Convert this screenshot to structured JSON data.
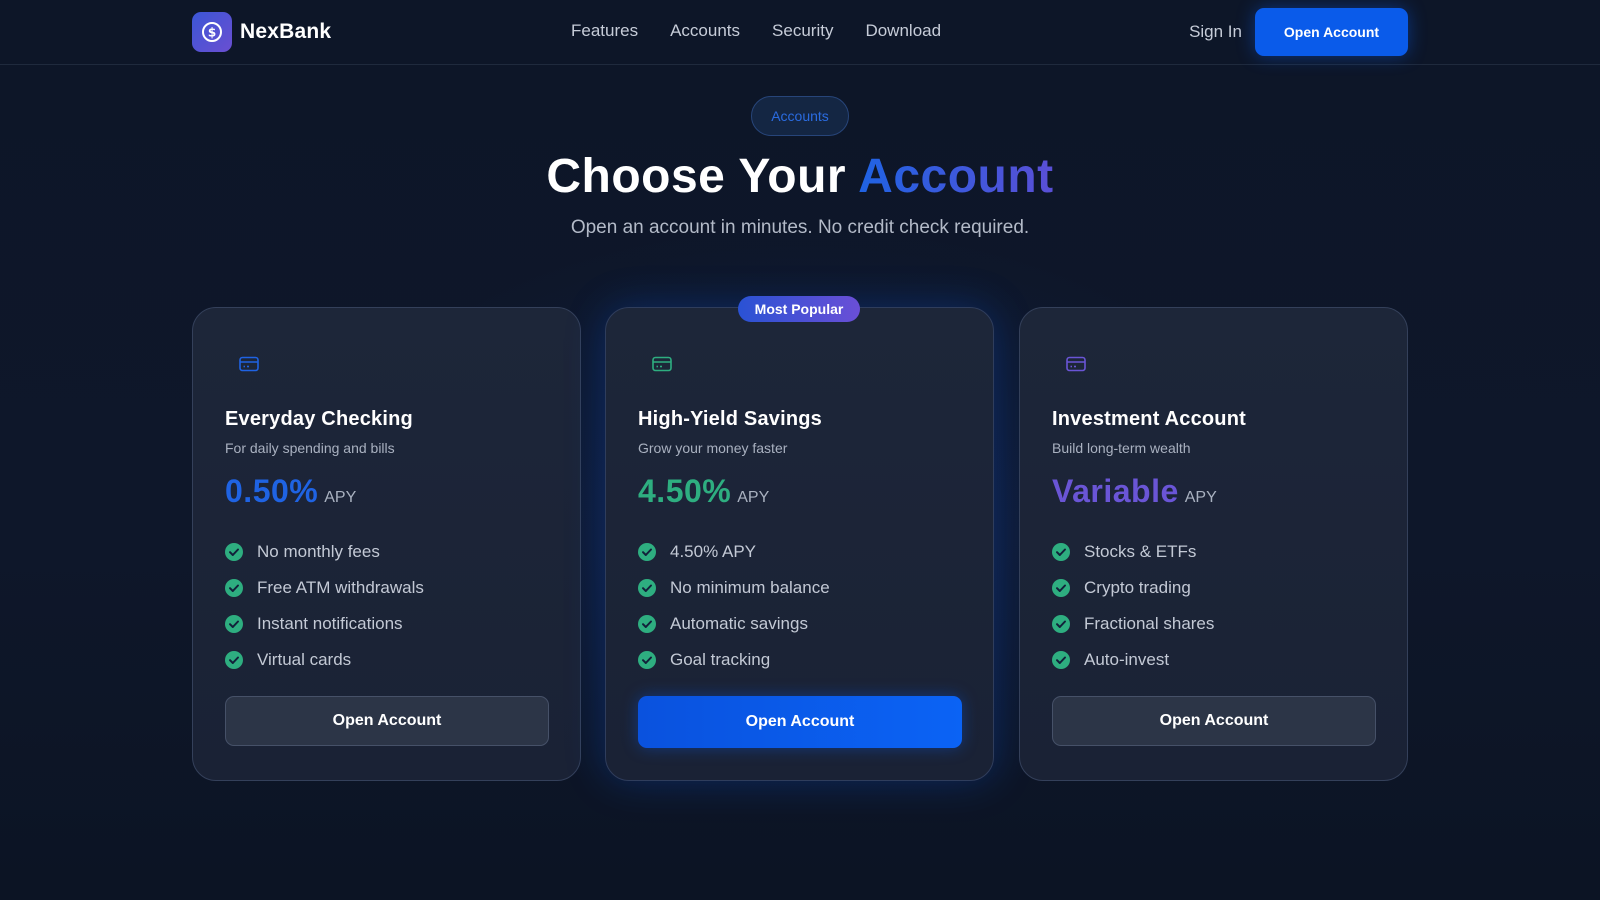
{
  "nav": {
    "brand": "NexBank",
    "links": [
      "Features",
      "Accounts",
      "Security",
      "Download"
    ],
    "sign_in": "Sign In",
    "cta": "Open Account"
  },
  "hero": {
    "badge": "Accounts",
    "title_prefix": "Choose Your ",
    "title_accent": "Account",
    "subtitle": "Open an account in minutes. No credit check required."
  },
  "cards": [
    {
      "title": "Everyday Checking",
      "description": "For daily spending and bills",
      "rate": "0.50%",
      "rate_unit": "APY",
      "features": [
        "No monthly fees",
        "Free ATM withdrawals",
        "Instant notifications",
        "Virtual cards"
      ],
      "button": "Open Account",
      "icon": "credit-card-icon",
      "accent_color": "#1f63e3"
    },
    {
      "badge": "Most Popular",
      "title": "High-Yield Savings",
      "description": "Grow your money faster",
      "rate": "4.50%",
      "rate_unit": "APY",
      "features": [
        "4.50% APY",
        "No minimum balance",
        "Automatic savings",
        "Goal tracking"
      ],
      "button": "Open Account",
      "icon": "credit-card-icon",
      "accent_color": "#2eae80"
    },
    {
      "title": "Investment Account",
      "description": "Build long-term wealth",
      "rate": "Variable",
      "rate_unit": "APY",
      "features": [
        "Stocks & ETFs",
        "Crypto trading",
        "Fractional shares",
        "Auto-invest"
      ],
      "button": "Open Account",
      "icon": "credit-card-icon",
      "accent_color": "#6a55d6"
    }
  ],
  "colors": {
    "primary": "#0a5bea",
    "check": "#2eae80",
    "background": "#0d1526"
  }
}
